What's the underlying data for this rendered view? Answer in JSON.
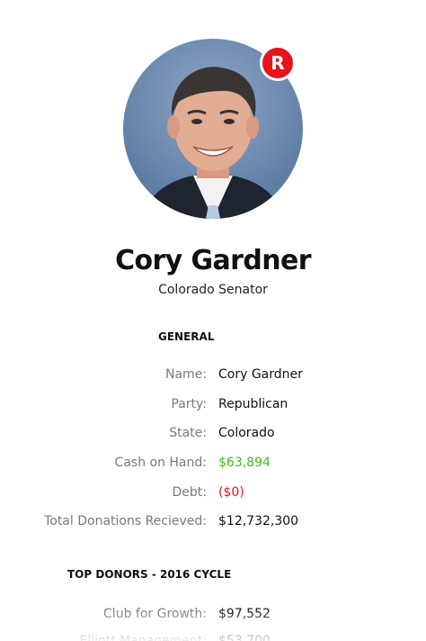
{
  "profile": {
    "name": "Cory Gardner",
    "title": "Colorado Senator",
    "party_badge": "R",
    "party_color": "#e8141c",
    "photo_icon": "portrait-photo"
  },
  "general": {
    "heading": "GENERAL",
    "rows": [
      {
        "label": "Name:",
        "value": "Cory Gardner"
      },
      {
        "label": "Party:",
        "value": "Republican"
      },
      {
        "label": "State:",
        "value": "Colorado"
      },
      {
        "label": "Cash on Hand:",
        "value": "$63,894"
      },
      {
        "label": "Debt:",
        "value": "($0)"
      },
      {
        "label": "Total Donations Recieved:",
        "value": "$12,732,300"
      }
    ]
  },
  "donors": {
    "heading": "TOP DONORS - 2016 CYCLE",
    "rows": [
      {
        "label": "Club for Growth:",
        "value": "$97,552"
      },
      {
        "label": "Elliott Management:",
        "value": "$53,700"
      }
    ]
  },
  "colors": {
    "positive": "#3fc01a",
    "negative": "#e8141c",
    "label": "#7a7a7a"
  }
}
